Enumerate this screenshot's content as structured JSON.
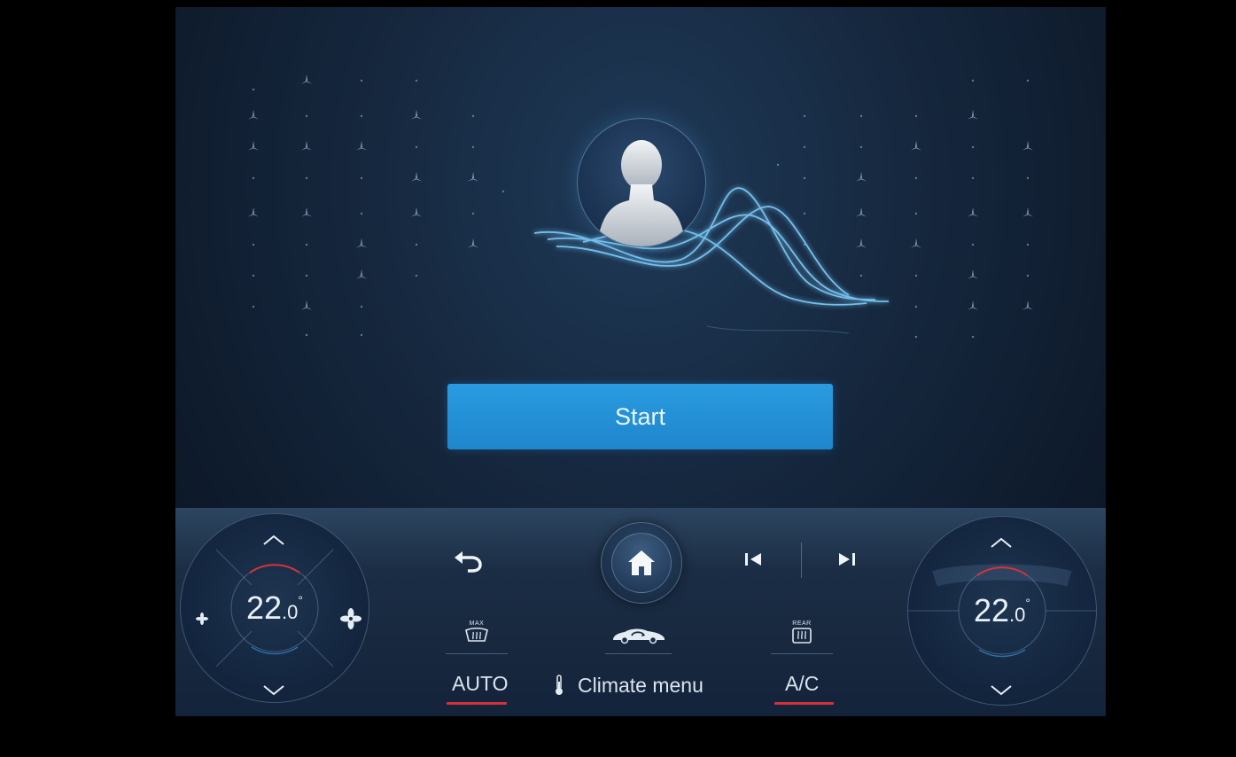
{
  "main": {
    "start_label": "Start"
  },
  "climate_left": {
    "temp_int": "22",
    "temp_dec": ".0",
    "temp_unit": "°"
  },
  "climate_right": {
    "temp_int": "22",
    "temp_dec": ".0",
    "temp_unit": "°"
  },
  "dock": {
    "auto_label": "AUTO",
    "climate_menu_label": "Climate menu",
    "ac_label": "A/C",
    "defrost_front_caption": "MAX",
    "defrost_rear_caption": "REAR"
  },
  "colors": {
    "accent_blue": "#2196db",
    "active_red": "#d9313c",
    "background": "#16283f"
  },
  "icons": [
    "fan-low-icon",
    "fan-high-icon",
    "chevron-up-icon",
    "chevron-down-icon",
    "back-arrow-icon",
    "home-icon",
    "previous-track-icon",
    "next-track-icon",
    "defrost-front-icon",
    "car-air-recirculation-icon",
    "defrost-rear-icon",
    "thermometer-icon",
    "user-profile-icon"
  ]
}
